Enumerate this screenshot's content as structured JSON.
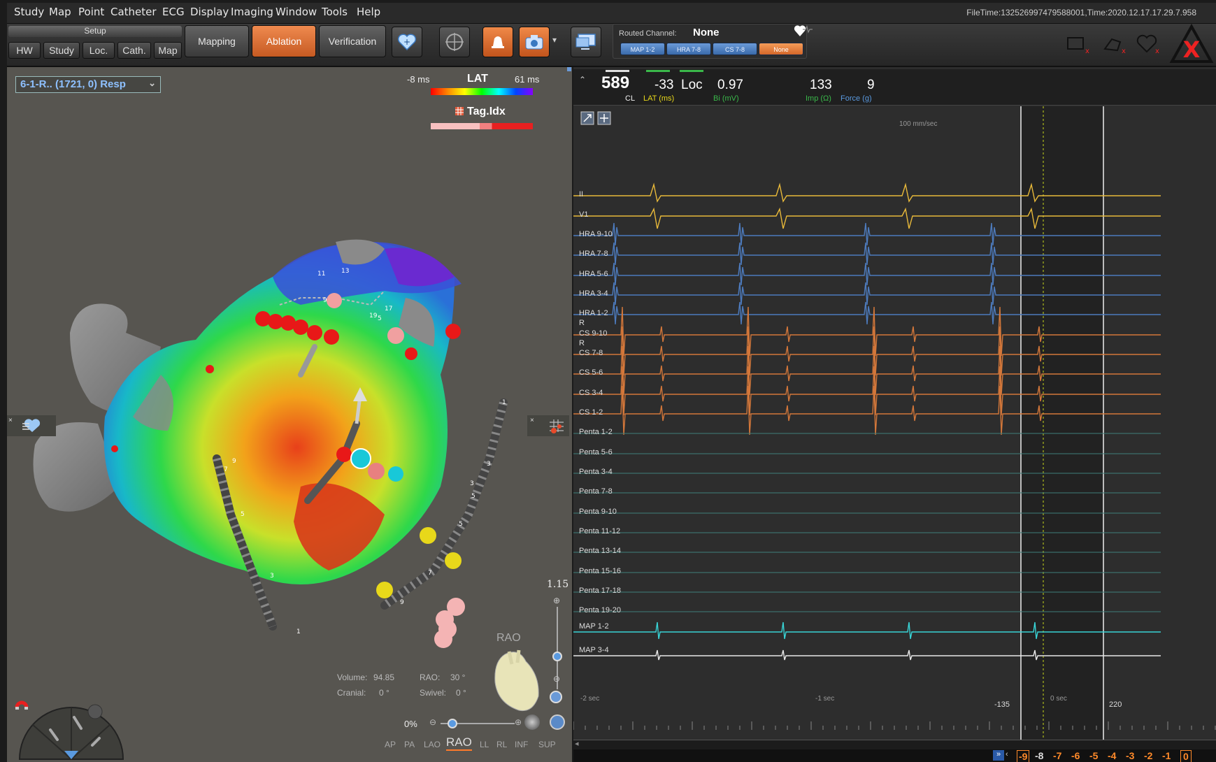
{
  "menubar": {
    "items": [
      "Study",
      "Map",
      "Point",
      "Catheter",
      "ECG",
      "Display",
      "Imaging",
      "Window",
      "Tools",
      "Help"
    ],
    "filetime": "FileTime:132526997479588001,Time:2020.12.17.17.29.7.958"
  },
  "toolbar": {
    "setup_title": "Setup",
    "setup_buttons": [
      "HW",
      "Study",
      "Loc.",
      "Cath.",
      "Map"
    ],
    "modes": [
      "Mapping",
      "Ablation",
      "Verification"
    ],
    "active_mode": "Ablation",
    "routed_channel_label": "Routed Channel:",
    "routed_channel_value": "None",
    "channel_buttons": [
      "MAP 1-2",
      "HRA 7-8",
      "CS 7-8",
      "None"
    ]
  },
  "map_view": {
    "dropdown": "6-1-R.. (1721, 0) Resp",
    "lat_min": "-8 ms",
    "lat_title": "LAT",
    "lat_max": "61 ms",
    "tag_label": "Tag.Idx",
    "zoom": "1.15",
    "orientation": "RAO",
    "volume_label": "Volume:",
    "volume_value": "94.85",
    "rao_label": "RAO:",
    "rao_value": "30 °",
    "cranial_label": "Cranial:",
    "cranial_value": "0 °",
    "swivel_label": "Swivel:",
    "swivel_value": "0 °",
    "opacity": "0%",
    "view_tabs": [
      "AP",
      "PA",
      "LAO",
      "RAO",
      "LL",
      "RL",
      "INF",
      "SUP"
    ],
    "active_view": "RAO",
    "electrode_numbers": [
      "11",
      "13",
      "9",
      "17",
      "19",
      "5",
      "1",
      "3",
      "5",
      "7",
      "9",
      "5",
      "3",
      "1",
      "3",
      "5",
      "7",
      "9"
    ]
  },
  "signals": {
    "cl_value": "589",
    "cl_label": "CL",
    "lat_value": "-33",
    "lat_label": "LAT (ms)",
    "loc_label": "Loc",
    "bi_value": "0.97",
    "bi_label": "Bi (mV)",
    "imp_value": "133",
    "imp_label": "Imp (Ω)",
    "force_value": "9",
    "force_label": "Force (g)",
    "speed": "100 mm/sec",
    "channels": [
      "II",
      "V1",
      "HRA 9-10",
      "HRA 7-8",
      "HRA 5-6",
      "HRA 3-4",
      "HRA 1-2",
      "CS 9-10",
      "CS 7-8",
      "CS 5-6",
      "CS 3-4",
      "CS 1-2",
      "Penta 1-2",
      "Penta 5-6",
      "Penta 3-4",
      "Penta 7-8",
      "Penta 9-10",
      "Penta 11-12",
      "Penta 13-14",
      "Penta 15-16",
      "Penta 17-18",
      "Penta 19-20",
      "MAP 1-2",
      "MAP 3-4"
    ],
    "time_labels": [
      "-2 sec",
      "-1 sec",
      "0 sec"
    ],
    "window_left": "-135",
    "window_right": "220",
    "r_markers": [
      "R",
      "R"
    ],
    "strip_numbers": [
      "-9",
      "-8",
      "-7",
      "-6",
      "-5",
      "-4",
      "-3",
      "-2",
      "-1",
      "0"
    ]
  },
  "colors": {
    "orange": "#ef7f3c",
    "yellow_trace": "#e8b93a",
    "blue_trace": "#4d7bbd",
    "orange_trace": "#d3773a",
    "teal_trace": "#3f7f7a",
    "cyan_trace": "#38d4d6"
  }
}
